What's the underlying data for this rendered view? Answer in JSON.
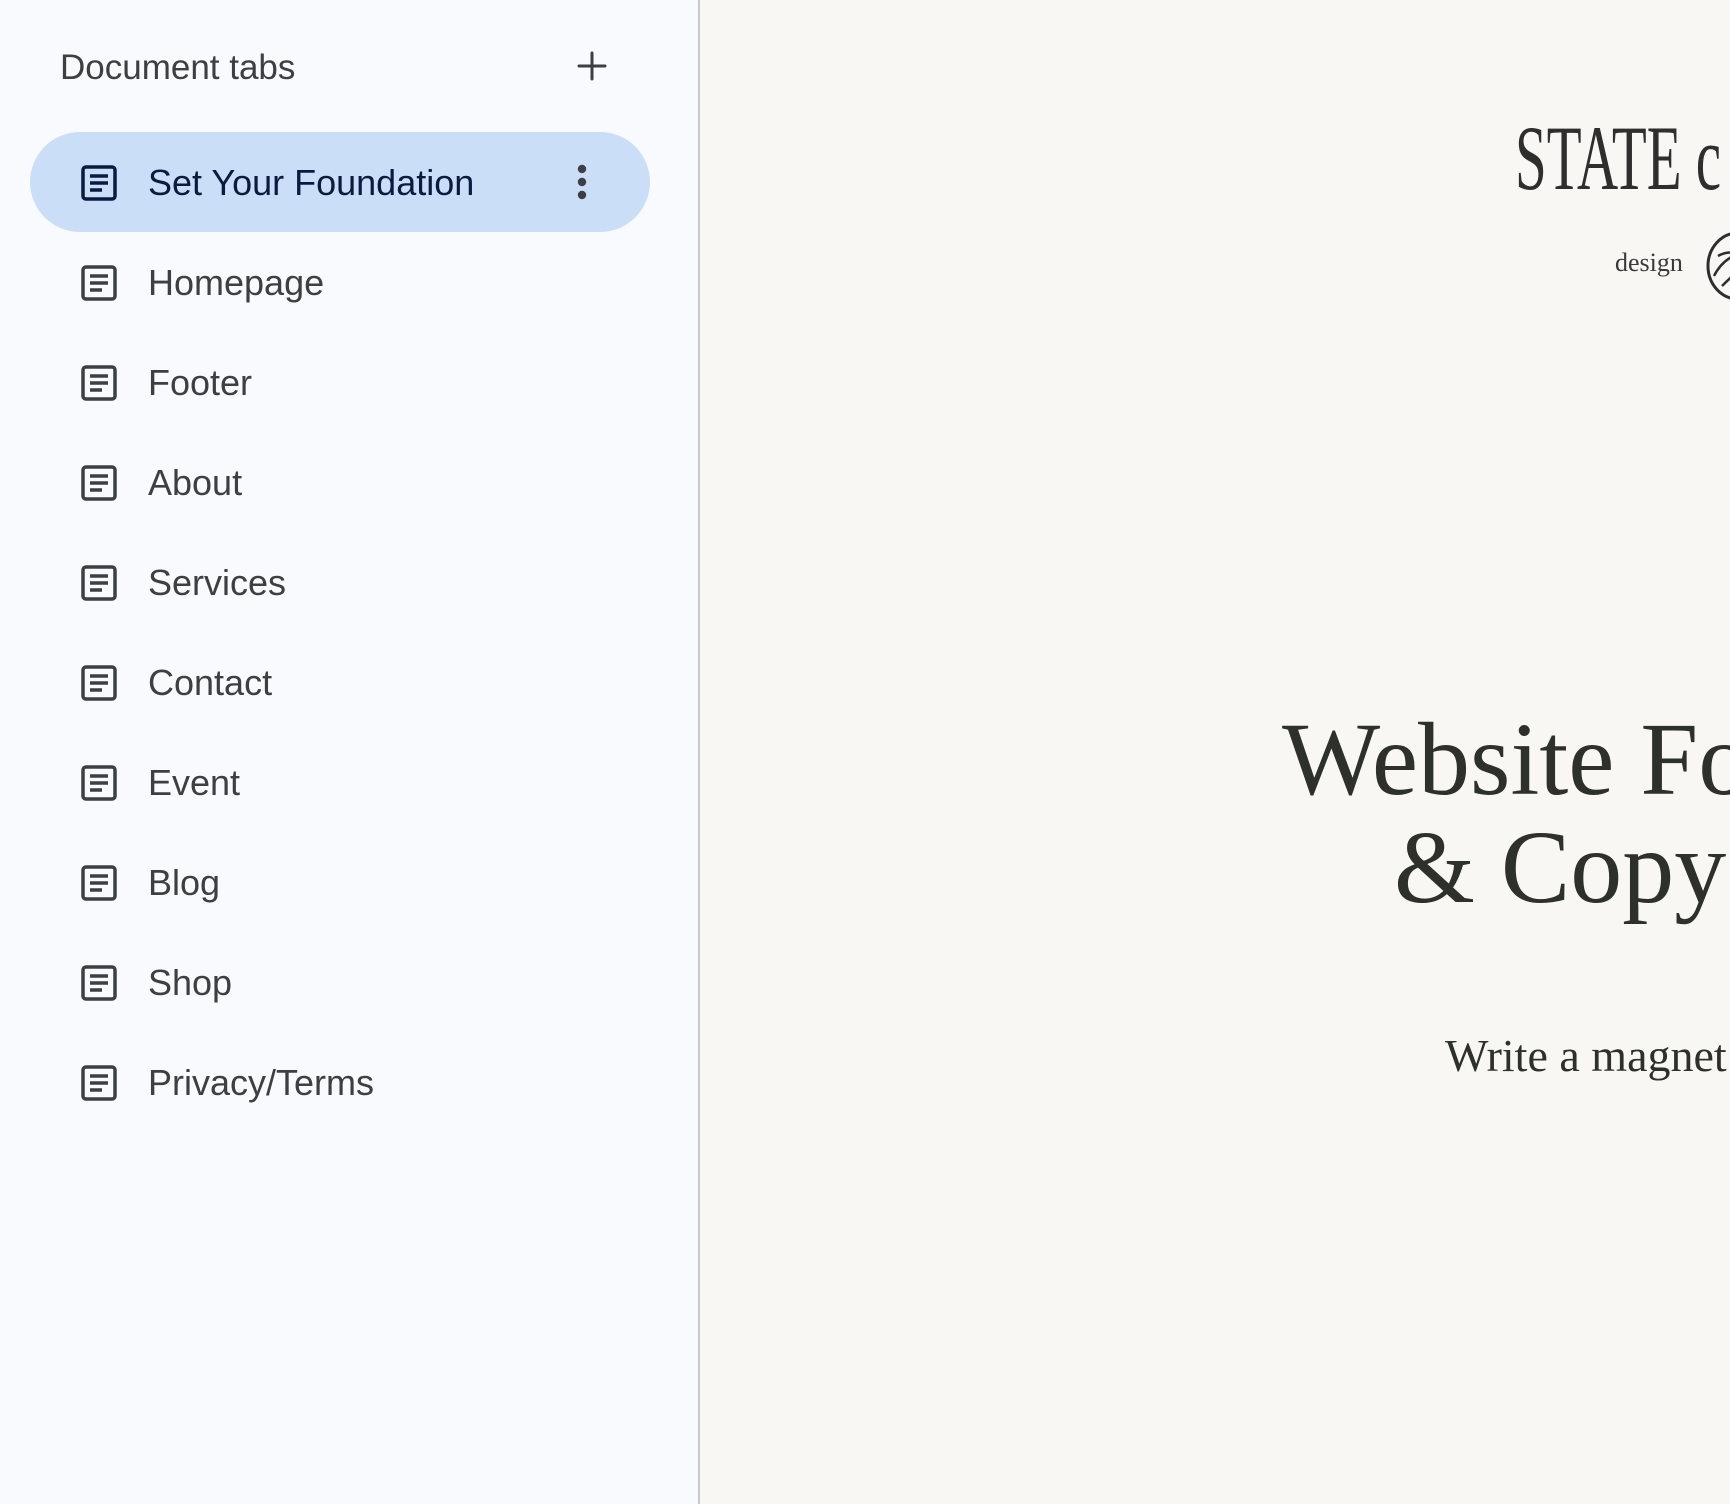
{
  "sidebar": {
    "title": "Document tabs",
    "add_icon": "plus-icon",
    "tab_icon": "document-icon",
    "menu_icon": "more-vert-icon",
    "active_color": "#cbdef8",
    "tabs": [
      {
        "label": "Set Your Foundation",
        "active": true
      },
      {
        "label": "Homepage"
      },
      {
        "label": "Footer"
      },
      {
        "label": "About"
      },
      {
        "label": "Services"
      },
      {
        "label": "Contact"
      },
      {
        "label": "Event"
      },
      {
        "label": "Blog"
      },
      {
        "label": "Shop"
      },
      {
        "label": "Privacy/Terms"
      }
    ]
  },
  "document": {
    "logo_word": "STATE c",
    "logo_sub": "design",
    "logo_mark_icon": "leaf-emblem-icon",
    "title_line1": "Website Fo",
    "title_line2": "& Copy",
    "subtitle": "Write a magnet"
  }
}
